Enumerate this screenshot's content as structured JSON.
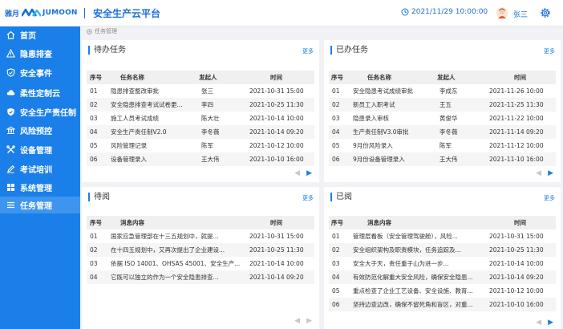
{
  "header": {
    "logo_cn": "雅月",
    "logo_en": "JUMOON",
    "app_title": "安全生产云平台",
    "datetime": "2021/11/29  10:00:00",
    "username": "张三"
  },
  "sidebar": {
    "items": [
      {
        "label": "首页",
        "icon": "home-icon"
      },
      {
        "label": "隐患排查",
        "icon": "warning-icon"
      },
      {
        "label": "安全事件",
        "icon": "shield-icon"
      },
      {
        "label": "柔性定制云",
        "icon": "cloud-icon"
      },
      {
        "label": "安全生产责任制",
        "icon": "shield-check-icon"
      },
      {
        "label": "风险预控",
        "icon": "bank-icon"
      },
      {
        "label": "设备管理",
        "icon": "tools-icon"
      },
      {
        "label": "考试培训",
        "icon": "pen-icon"
      },
      {
        "label": "系统管理",
        "icon": "grid-icon"
      },
      {
        "label": "任务管理",
        "icon": "list-icon"
      }
    ],
    "active": "任务管理"
  },
  "breadcrumb": "任务管理",
  "panels": {
    "todo": {
      "title": "待办任务",
      "more": "更多",
      "headers": {
        "no": "序号",
        "name": "任务名称",
        "initiator": "发起人",
        "time": "时间"
      },
      "rows": [
        {
          "no": "01",
          "name": "隐患排查整改审批",
          "initiator": "张三",
          "time": "2021-10-31  15:00"
        },
        {
          "no": "02",
          "name": "安全隐患排查考试试卷更...",
          "initiator": "李四",
          "time": "2021-10-25  11:30"
        },
        {
          "no": "03",
          "name": "施工人员考试成绩",
          "initiator": "陈大壮",
          "time": "2021-10-14  10:00"
        },
        {
          "no": "04",
          "name": "安全生产责任制V2.0",
          "initiator": "李冬薇",
          "time": "2021-10-14  09:20"
        },
        {
          "no": "05",
          "name": "风险管理记录",
          "initiator": "陈军",
          "time": "2021-10-12  10:00"
        },
        {
          "no": "06",
          "name": "设备管理录入",
          "initiator": "王大伟",
          "time": "2021-10-10  16:00"
        }
      ]
    },
    "done": {
      "title": "已办任务",
      "more": "更多",
      "headers": {
        "no": "序号",
        "name": "任务名称",
        "initiator": "发起人",
        "time": "时间"
      },
      "rows": [
        {
          "no": "01",
          "name": "安全隐患考试成绩审批",
          "initiator": "李成东",
          "time": "2021-11-26  10:00"
        },
        {
          "no": "02",
          "name": "新员工入职考试",
          "initiator": "王五",
          "time": "2021-11-25  11:30"
        },
        {
          "no": "03",
          "name": "隐患录入审核",
          "initiator": "黄俊华",
          "time": "2021-11-22  10:00"
        },
        {
          "no": "04",
          "name": "生产责任制V3.0审批",
          "initiator": "李冬薇",
          "time": "2021-11-14  09:20"
        },
        {
          "no": "05",
          "name": "9月份风险录入",
          "initiator": "陈军",
          "time": "2021-11-12  10:00"
        },
        {
          "no": "06",
          "name": "9月份设备管理录入",
          "initiator": "王大伟",
          "time": "2021-11-10  16:00"
        }
      ]
    },
    "pending": {
      "title": "待阅",
      "more": "更多",
      "headers": {
        "no": "序号",
        "content": "消息内容",
        "time": "时间"
      },
      "rows": [
        {
          "no": "01",
          "content": "国家应急管理部在十三五规划中，就提...",
          "time": "2021-10-31  15:00"
        },
        {
          "no": "02",
          "content": "在十四五规划中，又再次提出了企业建设...",
          "time": "2021-10-25  11:30"
        },
        {
          "no": "03",
          "content": "依据 ISO 14001、OHSAS 45001、安全生产...",
          "time": "2021-10-14  10:00"
        },
        {
          "no": "04",
          "content": "它既可以独立的作为一个安全隐患排查...",
          "time": "2021-10-14  09:20"
        }
      ]
    },
    "read": {
      "title": "已阅",
      "more": "更多",
      "headers": {
        "no": "序号",
        "content": "消息内容",
        "time": "时间"
      },
      "rows": [
        {
          "no": "01",
          "content": "管理层看板（安全管理驾驶舱），风险...",
          "time": "2021-10-31  15:00"
        },
        {
          "no": "02",
          "content": "安全组织架构及职责模块，任务追踪及...",
          "time": "2021-10-25  11:30"
        },
        {
          "no": "03",
          "content": "安全大于天，责任重于山为进一步...",
          "time": "2021-10-14  10:00"
        },
        {
          "no": "04",
          "content": "有效防范化解重大安全风险，确保安全隐患...",
          "time": "2021-10-14  09:20"
        },
        {
          "no": "05",
          "content": "重点检查了企业工艺设备、安全设施、教育...",
          "time": "2021-10-12  10:00"
        },
        {
          "no": "06",
          "content": "坚持边查边改，确保不留死角和盲区，对重...",
          "time": "2021-10-10  16:00"
        }
      ]
    }
  },
  "colors": {
    "primary": "#1a7fe8",
    "active_nav": "#3d95ef",
    "header_blue": "#1a6fd8"
  }
}
